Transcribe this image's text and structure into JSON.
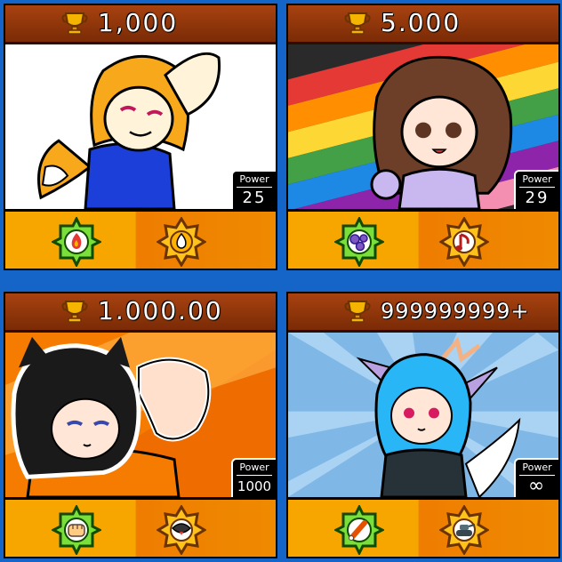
{
  "cards": [
    {
      "trophies": "1,000",
      "power_label": "Power",
      "power": "25",
      "gadget_icon": "fire-icon",
      "star_icon": "flame-drop-icon",
      "art": "fox-girl-white-bg"
    },
    {
      "trophies": "5.000",
      "power_label": "Power",
      "power": "29",
      "gadget_icon": "bubbles-icon",
      "star_icon": "music-note-icon",
      "art": "girl-rainbow-bg"
    },
    {
      "trophies": "1.000.00",
      "power_label": "Power",
      "power": "1000",
      "gadget_icon": "fist-icon",
      "star_icon": "bird-icon",
      "art": "catgirl-orange-bg"
    },
    {
      "trophies": "999999999+",
      "power_label": "Power",
      "power": "∞",
      "gadget_icon": "drumstick-icon",
      "star_icon": "tank-icon",
      "art": "dragon-girl-blue-bg"
    }
  ],
  "colors": {
    "frame": "#1565c8",
    "topbar": "#8f350a",
    "bottom_gold": "#f7a600",
    "bottom_orange": "#ef7d00",
    "gadget_green": "#3cb521",
    "star_gold": "#f7b500"
  }
}
